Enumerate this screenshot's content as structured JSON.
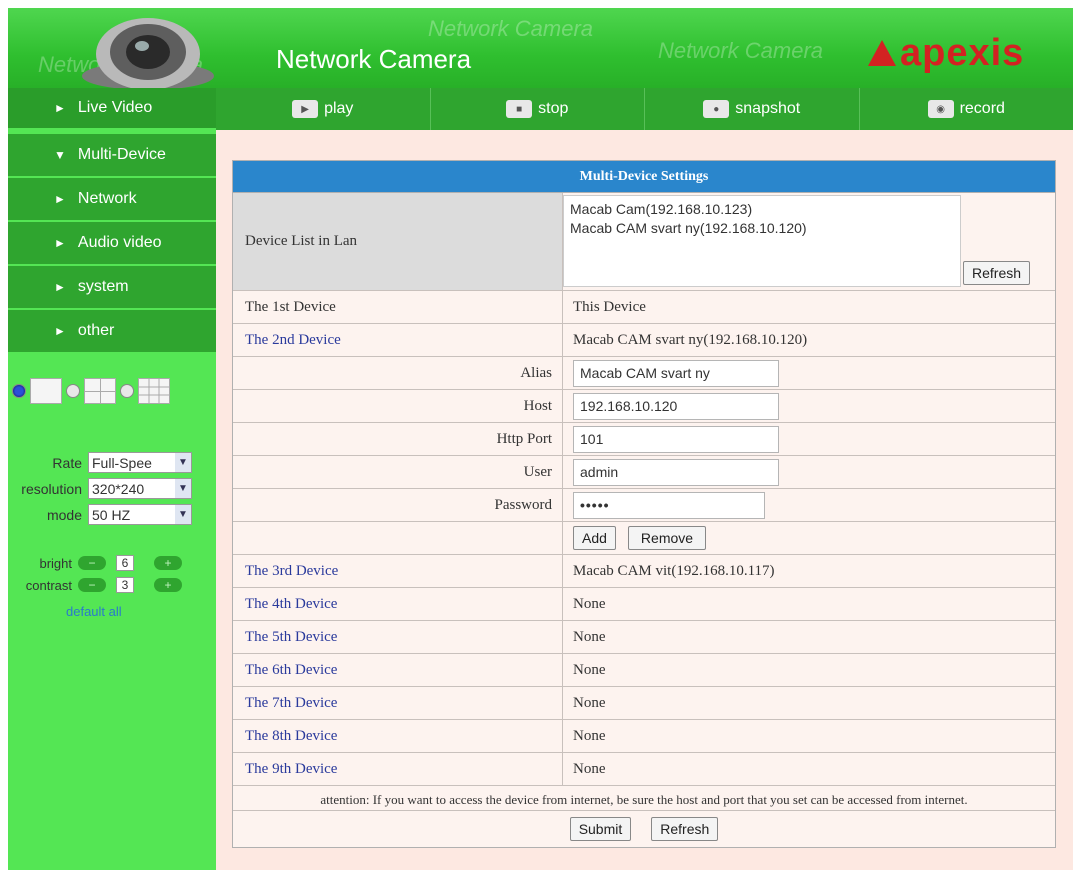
{
  "header": {
    "title": "Network Camera",
    "watermark": "Network Camera",
    "logo_text": "apexis",
    "logo_color": "#d32222"
  },
  "sidebar": {
    "items": [
      {
        "label": "Live Video",
        "arrow": "►"
      },
      {
        "label": "Multi-Device",
        "arrow": "▼"
      },
      {
        "label": "Network",
        "arrow": "►"
      },
      {
        "label": "Audio video",
        "arrow": "►"
      },
      {
        "label": "system",
        "arrow": "►"
      },
      {
        "label": "other",
        "arrow": "►"
      }
    ],
    "controls": {
      "rate_label": "Rate",
      "rate_value": "Full-Spee",
      "resolution_label": "resolution",
      "resolution_value": "320*240",
      "mode_label": "mode",
      "mode_value": "50 HZ",
      "bright_label": "bright",
      "bright_value": "6",
      "contrast_label": "contrast",
      "contrast_value": "3",
      "minus": "−",
      "plus": "+",
      "default_all": "default all"
    }
  },
  "toolbar": {
    "play": "play",
    "stop": "stop",
    "snapshot": "snapshot",
    "record": "record"
  },
  "panel": {
    "title": "Multi-Device Settings",
    "device_list_label": "Device List in Lan",
    "device_list": [
      "Macab Cam(192.168.10.123)",
      "Macab CAM svart ny(192.168.10.120)"
    ],
    "refresh": "Refresh",
    "device1_label": "The 1st Device",
    "device1_value": "This Device",
    "device2_label": "The 2nd Device",
    "device2_value": "Macab CAM svart ny(192.168.10.120)",
    "alias_label": "Alias",
    "alias_value": "Macab CAM svart ny",
    "host_label": "Host",
    "host_value": "192.168.10.120",
    "port_label": "Http Port",
    "port_value": "101",
    "user_label": "User",
    "user_value": "admin",
    "password_label": "Password",
    "password_value": "•••••",
    "add": "Add",
    "remove": "Remove",
    "devices": [
      {
        "label": "The 3rd Device",
        "value": "Macab CAM vit(192.168.10.117)"
      },
      {
        "label": "The 4th Device",
        "value": "None"
      },
      {
        "label": "The 5th Device",
        "value": "None"
      },
      {
        "label": "The 6th Device",
        "value": "None"
      },
      {
        "label": "The 7th Device",
        "value": "None"
      },
      {
        "label": "The 8th Device",
        "value": "None"
      },
      {
        "label": "The 9th Device",
        "value": "None"
      }
    ],
    "attention": "attention: If you want to access the device from internet, be sure the host and port that you set can be accessed from internet.",
    "submit": "Submit",
    "refresh_bottom": "Refresh"
  }
}
